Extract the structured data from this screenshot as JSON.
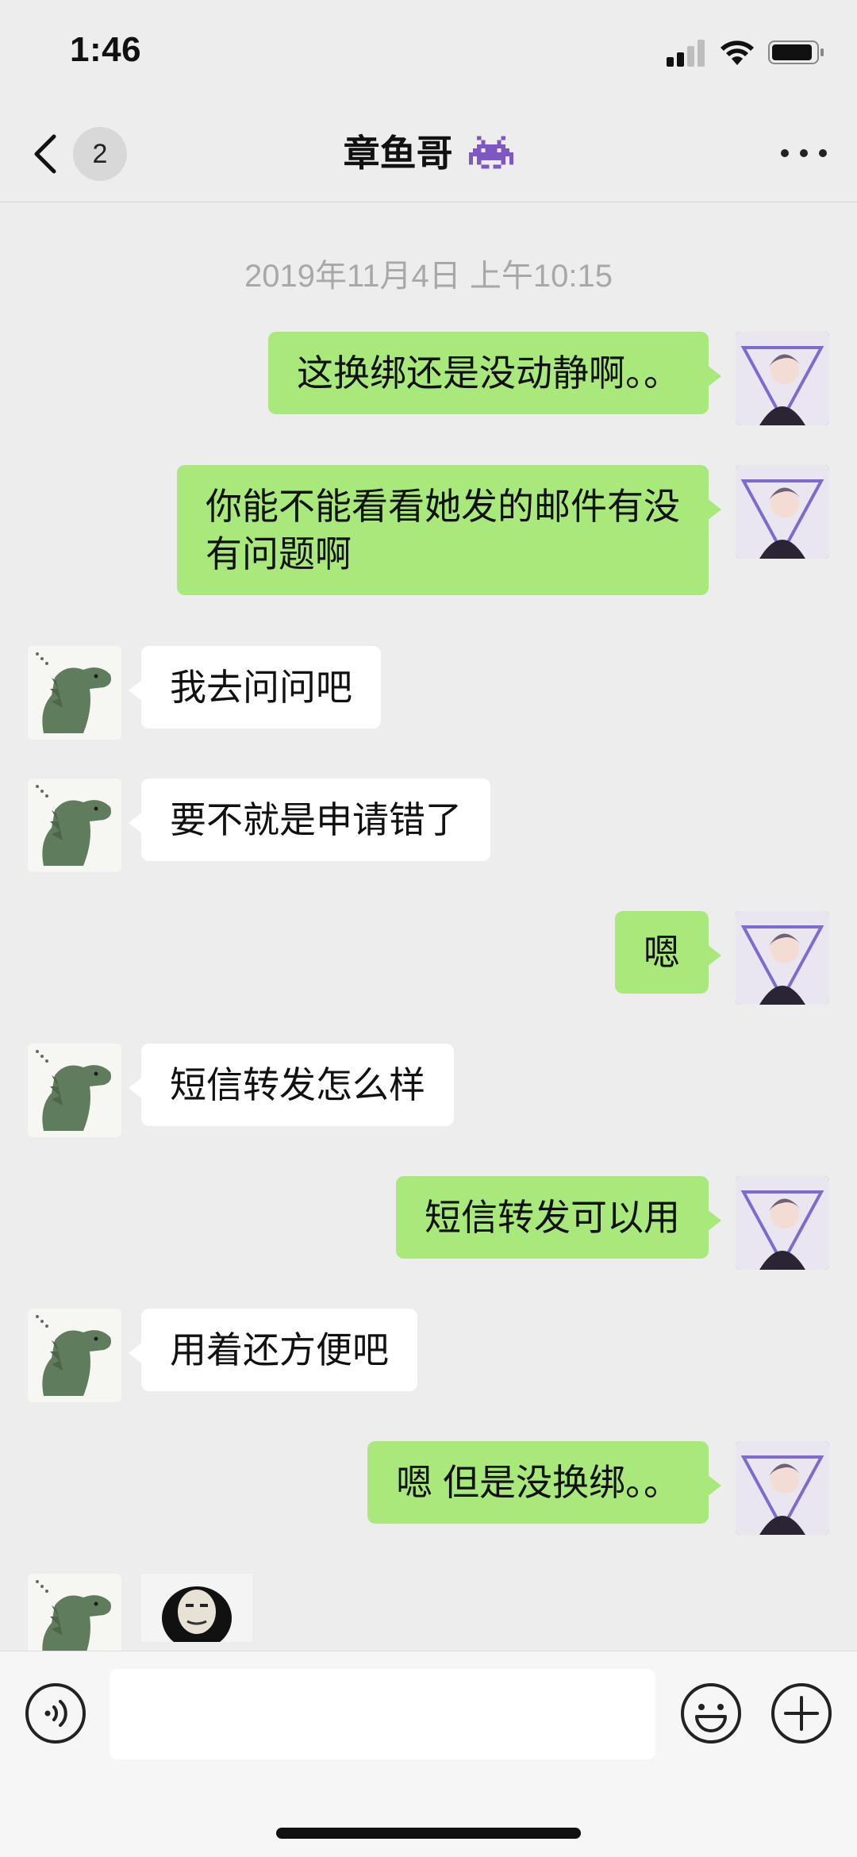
{
  "status_bar": {
    "time": "1:46"
  },
  "header": {
    "unread_count": "2",
    "title": "章鱼哥",
    "title_emoji": "alien-monster-emoji"
  },
  "timestamp": "2019年11月4日 上午10:15",
  "messages": [
    {
      "sender": "me",
      "text": "这换绑还是没动静啊。。"
    },
    {
      "sender": "me",
      "text": "你能不能看看她发的邮件有没\n有问题啊"
    },
    {
      "sender": "them",
      "text": "我去问问吧"
    },
    {
      "sender": "them",
      "text": "要不就是申请错了"
    },
    {
      "sender": "me",
      "text": "嗯"
    },
    {
      "sender": "them",
      "text": "短信转发怎么样"
    },
    {
      "sender": "me",
      "text": "短信转发可以用"
    },
    {
      "sender": "them",
      "text": "用着还方便吧"
    },
    {
      "sender": "me",
      "text": "嗯 但是没换绑。。"
    },
    {
      "sender": "them",
      "type": "sticker",
      "text": ""
    }
  ],
  "input_bar": {
    "input_value": "",
    "voice_icon": "voice-icon",
    "emoji_icon": "emoji-icon",
    "plus_icon": "plus-icon"
  },
  "colors": {
    "background": "#ededed",
    "my_bubble": "#a9e87a",
    "their_bubble": "#ffffff",
    "timestamp_text": "#a8a8a8"
  }
}
